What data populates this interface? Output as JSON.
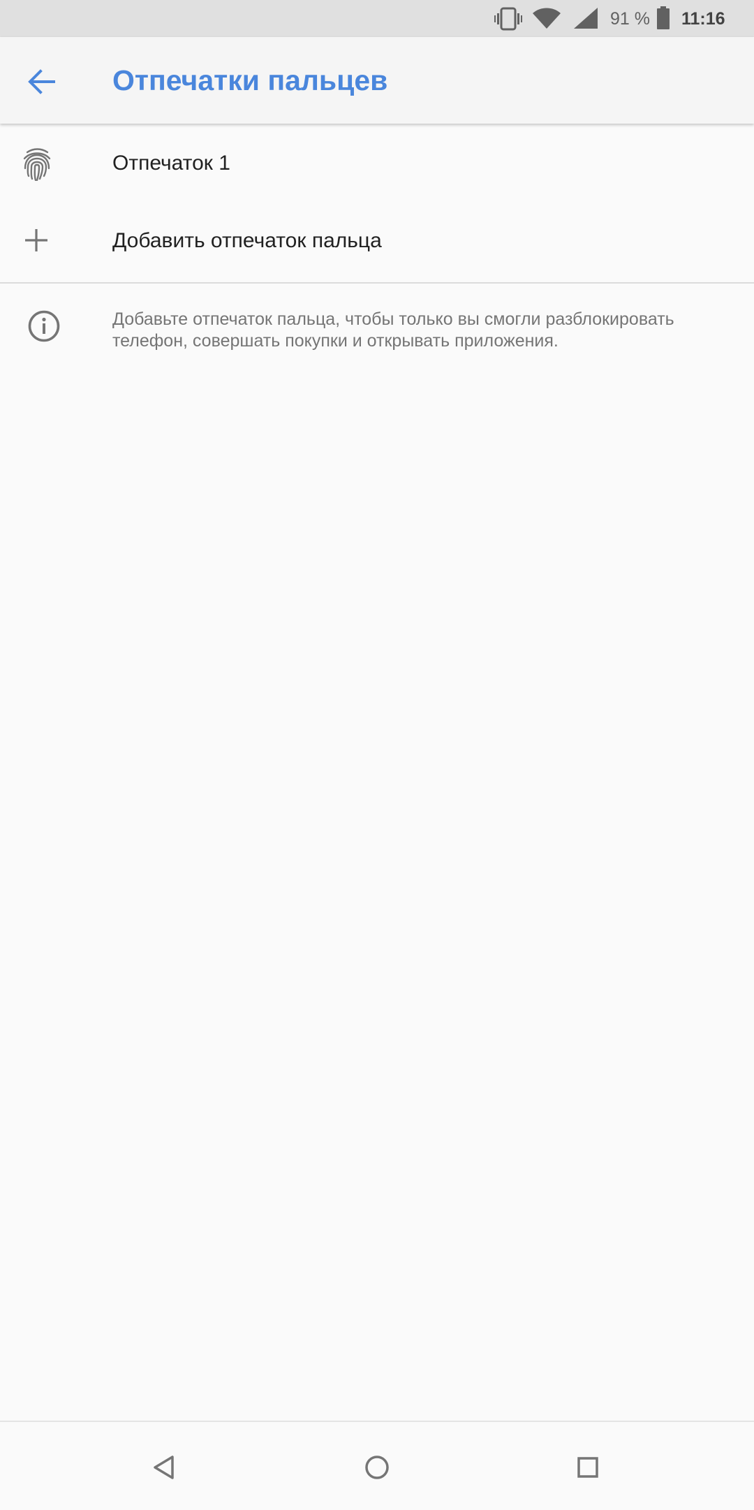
{
  "status_bar": {
    "battery_percent": "91 %",
    "time": "11:16",
    "icons": [
      "vibrate-icon",
      "wifi-icon",
      "signal-icon",
      "battery-icon"
    ],
    "battery_level": 0.91
  },
  "app_bar": {
    "title": "Отпечатки пальцев",
    "back_icon": "arrow-back-icon"
  },
  "list": {
    "items": [
      {
        "icon": "fingerprint-icon",
        "label": "Отпечаток 1"
      },
      {
        "icon": "add-icon",
        "label": "Добавить отпечаток пальца"
      }
    ]
  },
  "info": {
    "icon": "info-icon",
    "text": "Добавьте отпечаток пальца, чтобы только вы смогли разблокировать телефон, совершать покупки и открывать приложения."
  },
  "nav_bar": {
    "icons": [
      "back-triangle-icon",
      "home-circle-icon",
      "recents-square-icon"
    ]
  },
  "colors": {
    "accent": "#4a86dc",
    "status_bar_bg": "#e0e0e0",
    "app_bar_bg": "#f5f5f5",
    "background": "#fafafa",
    "primary_text": "#212121",
    "secondary_text": "#757575",
    "icon_gray": "#757575"
  }
}
